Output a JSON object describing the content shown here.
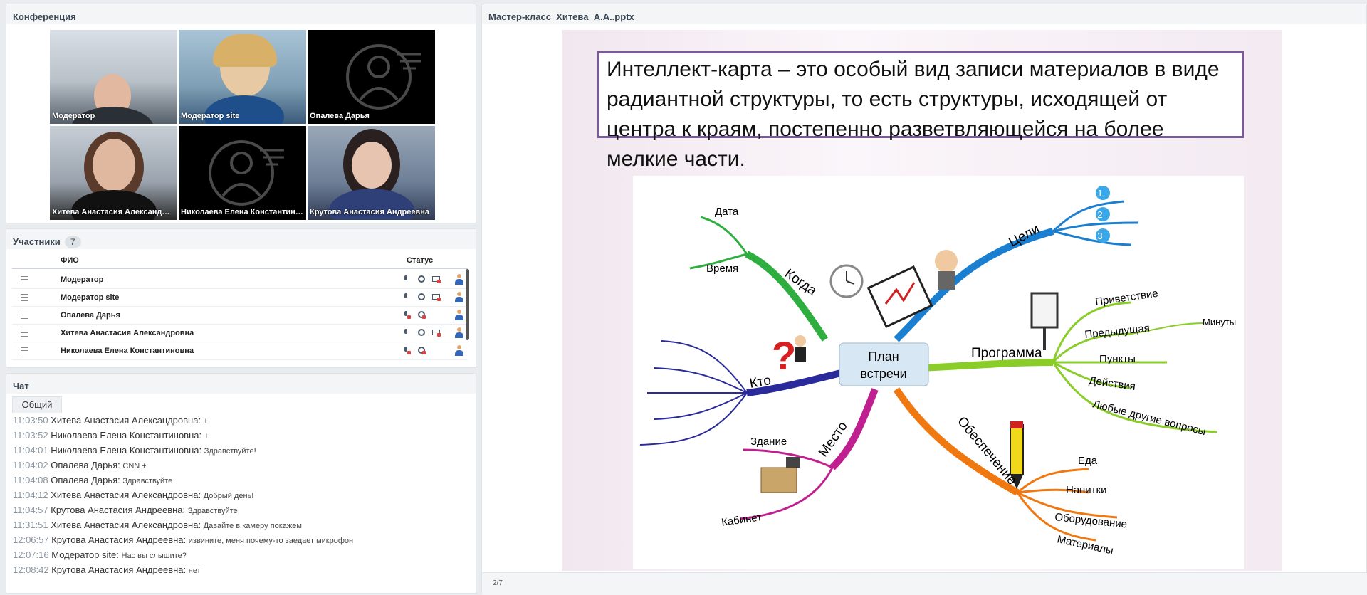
{
  "conference": {
    "title": "Конференция",
    "tiles": [
      {
        "name": "Модератор",
        "video": true
      },
      {
        "name": "Модератор site",
        "video": true
      },
      {
        "name": "Опалева  Дарья",
        "video": false
      },
      {
        "name": "Хитева Анастасия  Александровна",
        "video": true
      },
      {
        "name": "Николаева  Елена  Константиновна",
        "video": false
      },
      {
        "name": "Крутова Анастасия  Андреевна",
        "video": true
      }
    ]
  },
  "participants": {
    "title": "Участники",
    "count": "7",
    "col_name": "ФИО",
    "col_status": "Статус",
    "rows": [
      {
        "name": "Модератор",
        "mic": true,
        "cam": true
      },
      {
        "name": "Модератор site",
        "mic": true,
        "cam": true
      },
      {
        "name": "Опалева  Дарья",
        "mic": false,
        "cam": false
      },
      {
        "name": "Хитева Анастасия  Александровна",
        "mic": true,
        "cam": true
      },
      {
        "name": "Николаева  Елена  Константиновна",
        "mic": false,
        "cam": false
      }
    ]
  },
  "chat": {
    "title": "Чат",
    "tab": "Общий",
    "messages": [
      {
        "time": "11:03:50",
        "author": "Хитева Анастасия  Александровна:",
        "text": "+"
      },
      {
        "time": "11:03:52",
        "author": "Николаева  Елена  Константиновна:",
        "text": "+"
      },
      {
        "time": "11:04:01",
        "author": "Николаева  Елена  Константиновна:",
        "text": "Здравствуйте!"
      },
      {
        "time": "11:04:02",
        "author": "Опалева  Дарья:",
        "text": "CNN +"
      },
      {
        "time": "11:04:08",
        "author": "Опалева  Дарья:",
        "text": "Здравствуйте"
      },
      {
        "time": "11:04:12",
        "author": "Хитева Анастасия  Александровна:",
        "text": "Добрый день!"
      },
      {
        "time": "11:04:57",
        "author": "Крутова Анастасия  Андреевна:",
        "text": "Здравствуйте"
      },
      {
        "time": "11:31:51",
        "author": "Хитева Анастасия  Александровна:",
        "text": "Давайте в камеру покажем"
      },
      {
        "time": "12:06:57",
        "author": "Крутова Анастасия  Андреевна:",
        "text": "извините, меня почему-то заедает микрофон"
      },
      {
        "time": "12:07:16",
        "author": "Модератор site:",
        "text": "Нас вы слышите?"
      },
      {
        "time": "12:08:42",
        "author": "Крутова Анастасия  Андреевна:",
        "text": "нет"
      }
    ]
  },
  "presentation": {
    "title": "Мастер-класс_Хитева_А.А..pptx",
    "slide_heading": "Интеллект-карта – это особый вид записи материалов в виде радиантной структуры, то есть структуры, исходящей от центра к краям, постепенно разветвляющейся на более мелкие части.",
    "page": "2/7",
    "mindmap": {
      "center": [
        "План",
        "встречи"
      ],
      "branches": {
        "when": "Когда",
        "date": "Дата",
        "time": "Время",
        "goals": "Цели",
        "g1": "1",
        "g2": "2",
        "g3": "3",
        "program": "Программа",
        "greeting": "Приветствие",
        "previous": "Предыдущая",
        "minutes": "Минуты",
        "points": "Пункты",
        "actions": "Действия",
        "questions": "Любые другие вопросы",
        "who": "Кто",
        "place": "Место",
        "building": "Здание",
        "office": "Кабинет",
        "supply": "Обеспечение",
        "food": "Еда",
        "drinks": "Напитки",
        "equipment": "Оборудование",
        "materials": "Материалы"
      }
    },
    "colors": {
      "when": "#2eae3f",
      "goals": "#1a7fd0",
      "program": "#8acc28",
      "who": "#2a2a9a",
      "place": "#c0208f",
      "supply": "#f07810",
      "frame": "#7a5b9a"
    }
  }
}
